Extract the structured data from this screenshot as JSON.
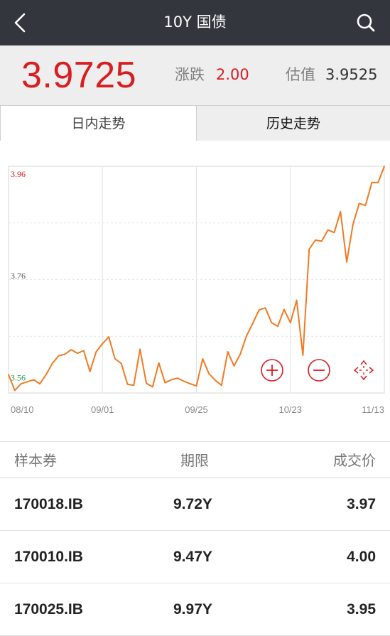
{
  "header": {
    "title": "10Y 国债",
    "back_icon": "chevron-left-icon",
    "search_icon": "search-icon"
  },
  "quote": {
    "price": "3.9725",
    "change_label": "涨跌",
    "change_value": "2.00",
    "estimate_label": "估值",
    "estimate_value": "3.9525"
  },
  "tabs": [
    {
      "label": "日内走势",
      "active": true
    },
    {
      "label": "历史走势",
      "active": false
    }
  ],
  "chart_data": {
    "type": "line",
    "series": [
      {
        "values": [
          3.566,
          3.535,
          3.548,
          3.552,
          3.556,
          3.548,
          3.566,
          3.588,
          3.603,
          3.606,
          3.615,
          3.608,
          3.613,
          3.572,
          3.611,
          3.627,
          3.64,
          3.597,
          3.588,
          3.547,
          3.545,
          3.616,
          3.549,
          3.542,
          3.589,
          3.55,
          3.556,
          3.559,
          3.553,
          3.548,
          3.544,
          3.597,
          3.568,
          3.555,
          3.545,
          3.611,
          3.583,
          3.606,
          3.642,
          3.667,
          3.693,
          3.697,
          3.668,
          3.661,
          3.694,
          3.668,
          3.712,
          3.604,
          3.812,
          3.83,
          3.828,
          3.85,
          3.845,
          3.886,
          3.787,
          3.861,
          3.902,
          3.898,
          3.943,
          3.943,
          3.975
        ]
      }
    ],
    "x_ticks": [
      "08/10",
      "09/01",
      "09/25",
      "10/23",
      "11/13"
    ],
    "y_ticks": [
      "3.96",
      "3.76",
      "3.56"
    ],
    "y_tick_colors": [
      "#d81e21",
      "#555555",
      "#1f9a4a"
    ],
    "ylim": [
      3.53,
      3.975
    ],
    "line_color": "#f07a22",
    "grid": true,
    "controls": [
      {
        "name": "zoom-in-icon",
        "glyph": "+"
      },
      {
        "name": "zoom-out-icon",
        "glyph": "−"
      },
      {
        "name": "fullscreen-icon",
        "glyph": "⤢"
      }
    ]
  },
  "table": {
    "headers": [
      "样本券",
      "期限",
      "成交价"
    ],
    "rows": [
      [
        "170018.IB",
        "9.72Y",
        "3.97"
      ],
      [
        "170010.IB",
        "9.47Y",
        "4.00"
      ],
      [
        "170025.IB",
        "9.97Y",
        "3.95"
      ]
    ]
  },
  "colors": {
    "up": "#d81e21",
    "down": "#1f9a4a",
    "header_bg": "#33373d",
    "line": "#f07a22"
  }
}
